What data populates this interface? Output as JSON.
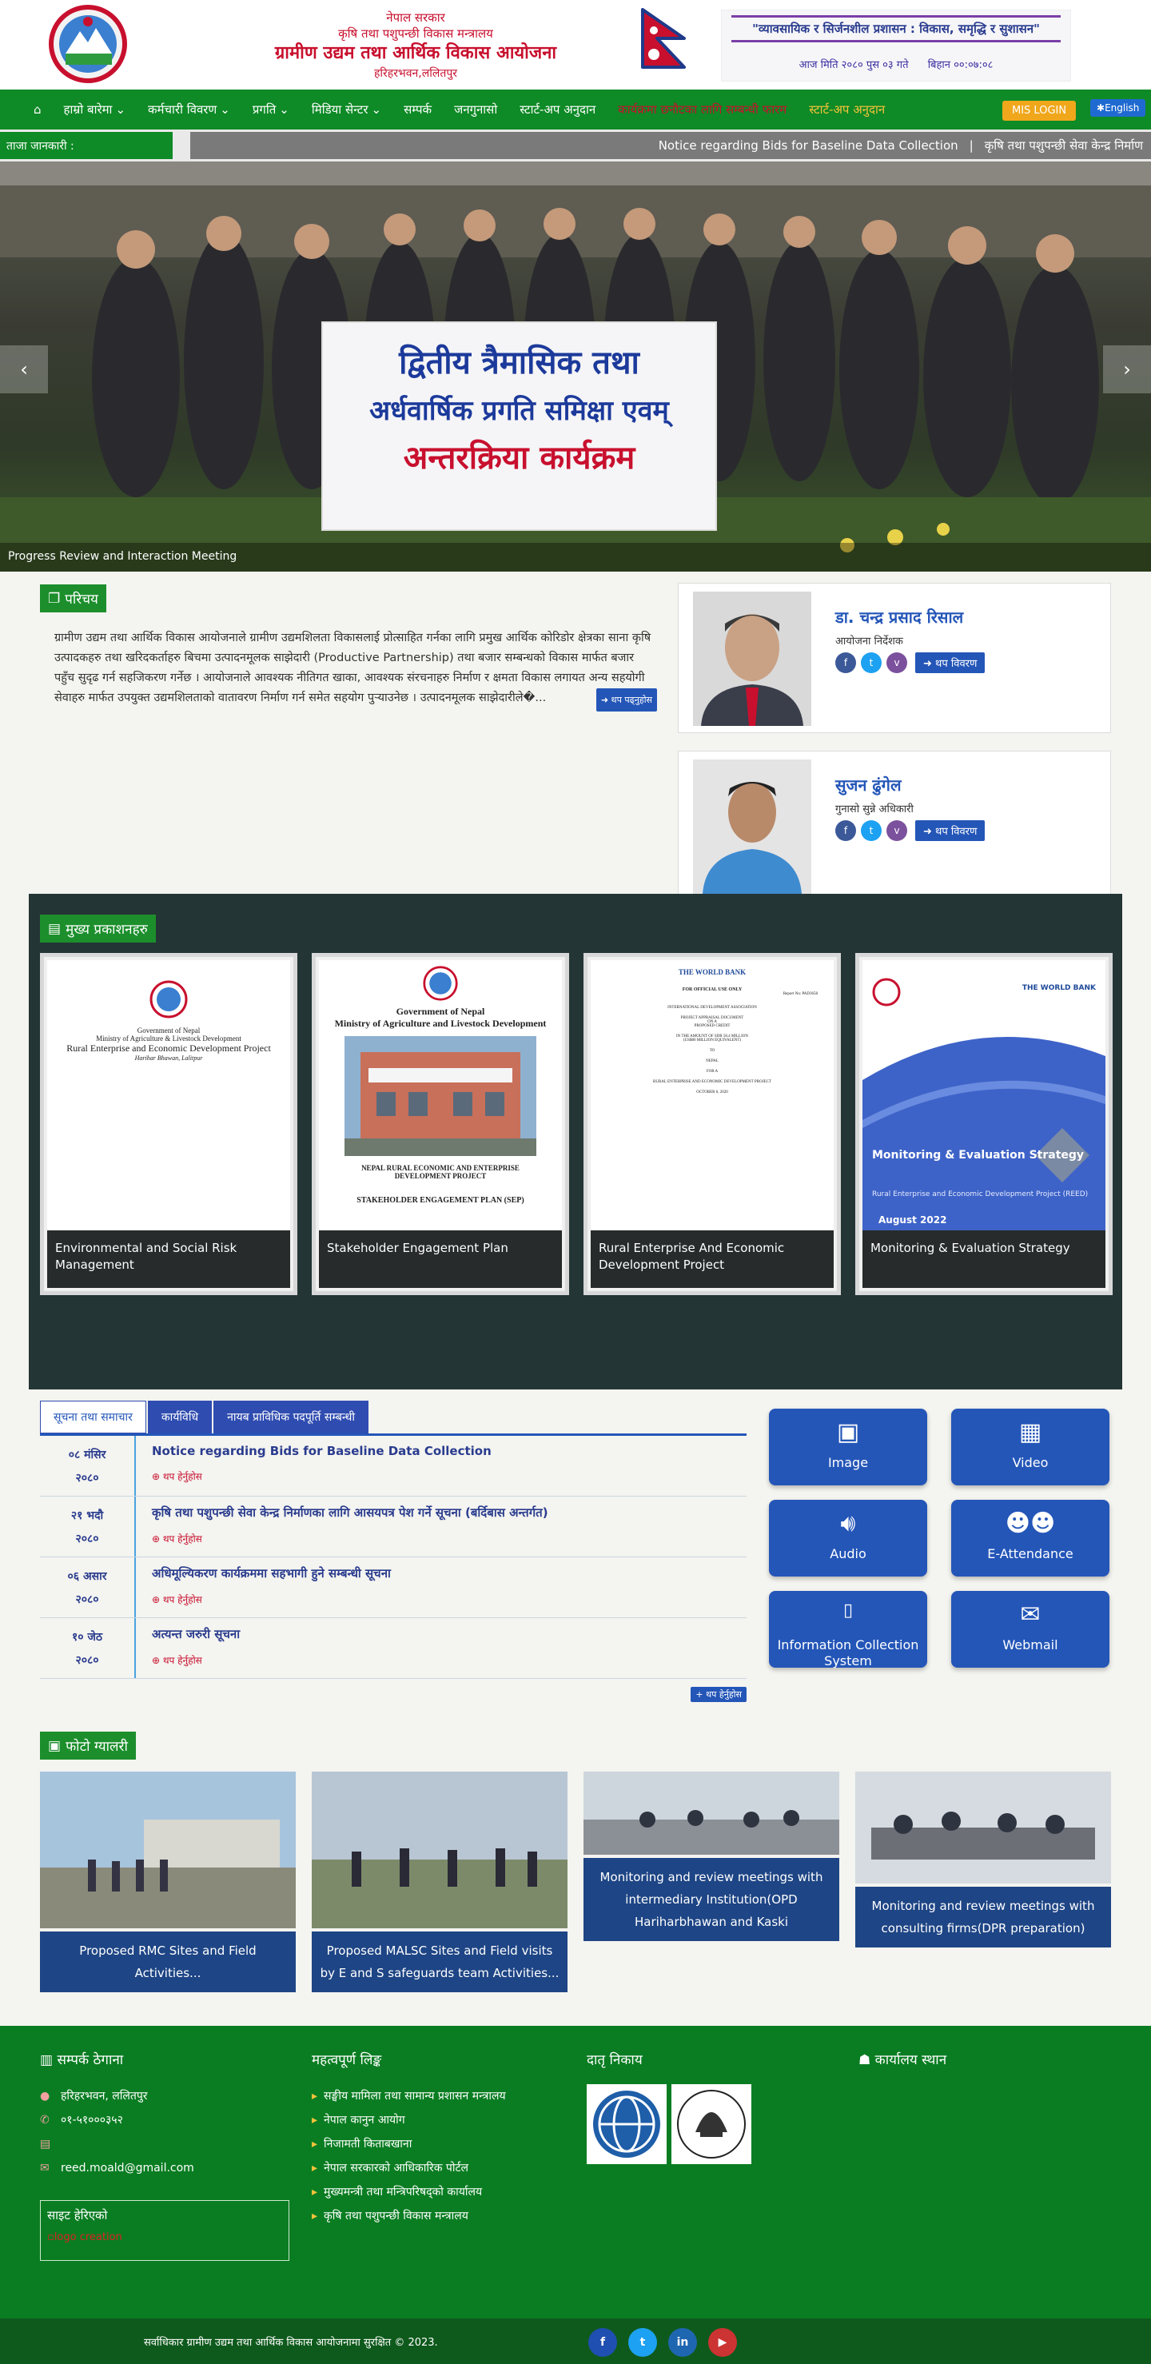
{
  "header": {
    "gov": "नेपाल सरकार",
    "ministry": "कृषि तथा पशुपन्छी विकास मन्त्रालय",
    "org_name": "ग्रामीण उद्यम तथा आर्थिक विकास आयोजना",
    "address": "हरिहरभवन,ललितपुर",
    "slogan": "\"व्यावसायिक र सिर्जनशील प्रशासन : विकास, समृद्धि र सुशासन\"",
    "date_label": "आज मिति २०८० पुस ०३ गते",
    "time_label": "बिहान ००:०७:०८"
  },
  "nav": {
    "items": [
      {
        "label": "हाम्रो बारेमा",
        "dropdown": true
      },
      {
        "label": "कर्मचारी विवरण",
        "dropdown": true
      },
      {
        "label": "प्रगति",
        "dropdown": true
      },
      {
        "label": "मिडिया सेन्टर",
        "dropdown": true
      },
      {
        "label": "सम्पर्क",
        "dropdown": false
      },
      {
        "label": "जनगुनासो",
        "dropdown": false
      },
      {
        "label": "स्टार्ट-अप अनुदान",
        "dropdown": false
      }
    ],
    "highlight_red": "कार्यक्रमा छनौटका लागि सम्बन्धी फारम",
    "highlight_gold": "स्टार्ट-अप अनुदान",
    "mis_login": "MIS LOGIN",
    "english": "English"
  },
  "ticker": {
    "label": "ताजा जानकारी :",
    "items": [
      "Notice regarding Bids for Baseline Data Collection",
      "कृषि तथा पशुपन्छी सेवा केन्द्र निर्माण"
    ]
  },
  "slider": {
    "banner_line1": "द्वितीय त्रैमासिक तथा",
    "banner_line2": "अर्धवार्षिक प्रगति समिक्षा एवम्",
    "banner_line3": "अन्तरक्रिया कार्यक्रम",
    "caption": "Progress Review and Interaction Meeting"
  },
  "intro": {
    "tag": "परिचय",
    "text": "ग्रामीण उद्यम तथा आर्थिक विकास आयोजनाले ग्रामीण उद्यमशिलता विकासलाई प्रोत्साहित गर्नका लागि प्रमुख आर्थिक कोरिडोर क्षेत्रका साना कृषि उत्पादकहरु तथा खरिदकर्ताहरु बिचमा उत्पादनमूलक साझेदारी (Productive Partnership) तथा बजार सम्बन्धको विकास मार्फत बजार पहुँच सुदृढ गर्न सहजिकरण गर्नेछ । आयोजनाले आवश्यक नीतिगत खाका, आवश्यक संरचनाहरु निर्माण र क्षमता विकास लगायत अन्य सहयोगी सेवाहरु मार्फत उपयुक्त उद्यमशिलताको वातावरण निर्माण गर्न समेत सहयोग पुऱ्याउनेछ । उत्पादनमूलक साझेदारीले�...",
    "read_more": "थप पढ्नुहोस"
  },
  "officials": [
    {
      "name": "डा. चन्द्र प्रसाद रिसाल",
      "role": "आयोजना निर्देशक",
      "detail": "थप विवरण"
    },
    {
      "name": "सुजन ढुंगेल",
      "role": "गुनासो सुन्ने अधिकारी",
      "detail": "थप विवरण"
    }
  ],
  "publications": {
    "tag": "मुख्य प्रकाशनहरु",
    "items": [
      {
        "title": "Environmental and Social Risk Management",
        "cover_lines": [
          "Government of Nepal",
          "Ministry of Agriculture & Livestock Development",
          "Rural Enterprise and Economic Development Project",
          "Harihar Bhawan, Lalitpur"
        ]
      },
      {
        "title": "Stakeholder Engagement Plan",
        "cover_lines": [
          "Government of Nepal",
          "Ministry of Agriculture and Livestock Development",
          "NEPAL RURAL ECONOMIC AND ENTERPRISE DEVELOPMENT PROJECT",
          "STAKEHOLDER ENGAGEMENT PLAN (SEP)"
        ]
      },
      {
        "title": "Rural Enterprise And Economic Development Project",
        "cover_lines": [
          "THE WORLD BANK",
          "FOR OFFICIAL USE ONLY",
          "Report No: PAD3658",
          "INTERNATIONAL DEVELOPMENT ASSOCIATION",
          "PROJECT APPRAISAL DOCUMENT",
          "ON A",
          "PROPOSED CREDIT",
          "IN THE AMOUNT OF SDR 58.4 MILLION",
          "(US$80 MILLION EQUIVALENT)",
          "TO",
          "NEPAL",
          "FOR A",
          "RURAL ENTERPRISE AND ECONOMIC DEVELOPMENT PROJECT",
          "OCTOBER 6, 2020"
        ]
      },
      {
        "title": "Monitoring & Evaluation Strategy",
        "cover_lines": [
          "THE WORLD BANK",
          "Monitoring & Evaluation Strategy",
          "Rural Enterprise and Economic Development Project (REED)",
          "August 2022"
        ]
      }
    ]
  },
  "notices": {
    "tabs": [
      "सूचना तथा समाचार",
      "कार्यविधि",
      "नायब प्राविधिक पदपूर्ति सम्बन्धी"
    ],
    "items": [
      {
        "day": "०८ मंसिर",
        "year": "२०८०",
        "title": "Notice regarding Bids for Baseline Data Collection"
      },
      {
        "day": "२१ भदौ",
        "year": "२०८०",
        "title": "कृषि तथा पशुपन्छी सेवा केन्द्र निर्माणका लागि आसयपत्र पेश गर्ने सूचना (बर्दिबास अन्तर्गत)"
      },
      {
        "day": "०६ असार",
        "year": "२०८०",
        "title": "अधिमूल्यिकरण कार्यक्रममा सहभागी हुने सम्बन्धी सूचना"
      },
      {
        "day": "१० जेठ",
        "year": "२०८०",
        "title": "अत्यन्त जरुरी सूचना"
      }
    ],
    "item_more": "थप हेर्नुहोस",
    "all_more": "थप हेर्नुहोस"
  },
  "tiles": [
    {
      "label": "Image",
      "icon": "image-icon"
    },
    {
      "label": "Video",
      "icon": "film-icon"
    },
    {
      "label": "Audio",
      "icon": "speaker-icon"
    },
    {
      "label": "E-Attendance",
      "icon": "users-icon"
    },
    {
      "label": "Information Collection System",
      "icon": "mobile-icon"
    },
    {
      "label": "Webmail",
      "icon": "mail-icon"
    }
  ],
  "gallery": {
    "tag": "फोटो ग्यालरी",
    "items": [
      {
        "caption": "Proposed RMC Sites and Field Activities..."
      },
      {
        "caption": "Proposed MALSC Sites and Field visits by E and S safeguards team Activities..."
      },
      {
        "caption": "Monitoring and review meetings with intermediary Institution(OPD Hariharbhawan and Kaski"
      },
      {
        "caption": "Monitoring and review meetings with consulting firms(DPR preparation)"
      }
    ]
  },
  "footer": {
    "contact_head": "सम्पर्क ठेगाना",
    "address": "हरिहरभवन, ललितपुर",
    "phone": "०१-५१०००३५२",
    "fax": "",
    "email": "reed.moald@gmail.com",
    "links_head": "महत्वपूर्ण लिङ्क",
    "links": [
      "सङ्घीय मामिला तथा सामान्य प्रशासन मन्त्रालय",
      "नेपाल कानुन आयोग",
      "निजामती किताबखाना",
      "नेपाल सरकारको आधिकारिक पोर्टल",
      "मुख्यमन्त्री तथा मन्त्रिपरिषद्को कार्यालय",
      "कृषि तथा पशुपन्छी विकास मन्त्रालय"
    ],
    "donors_head": "दातृ निकाय",
    "office_head": "कार्यालय स्थान",
    "counter_head": "साइट हेरिएको",
    "counter_img_alt": "logo creation",
    "copyright": "सर्वाधिकार ग्रामीण उद्यम तथा आर्थिक विकास आयोजनामा सुरक्षित © 2023."
  }
}
